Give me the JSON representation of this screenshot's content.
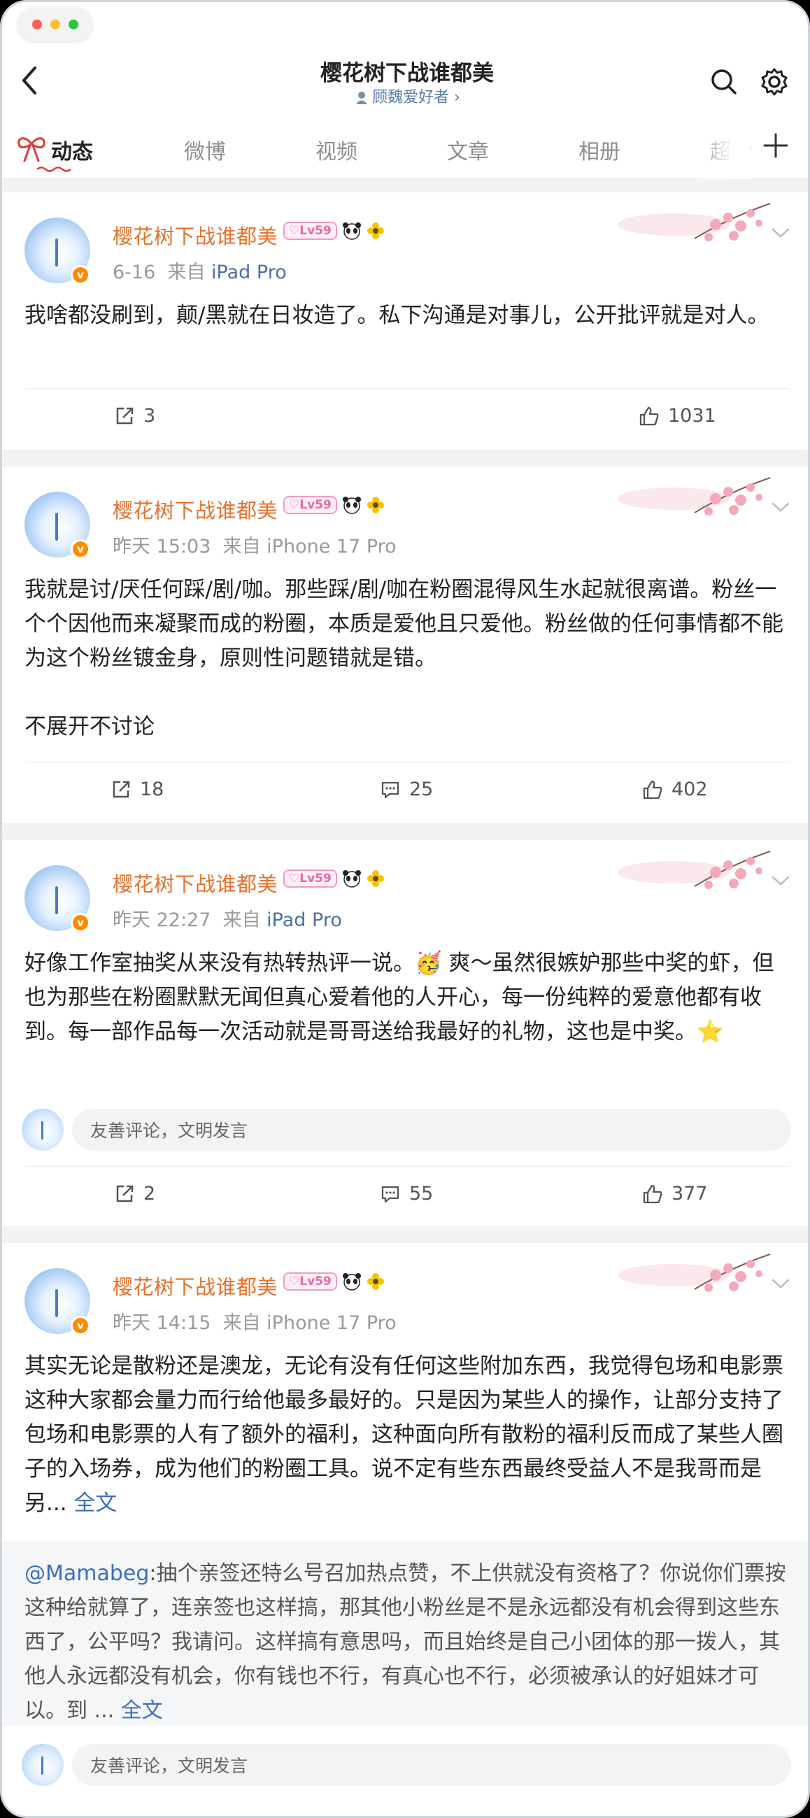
{
  "header": {
    "title": "樱花树下战谁都美",
    "subtitle": "顾魏爱好者",
    "subtitle_chevron": "›"
  },
  "tabs": [
    {
      "label": "动态",
      "active": true
    },
    {
      "label": "微博"
    },
    {
      "label": "视频"
    },
    {
      "label": "文章"
    },
    {
      "label": "相册"
    },
    {
      "label": "超话"
    }
  ],
  "colors": {
    "accent": "#e8712a",
    "link": "#3b6fbe",
    "tab_active_bow": "#e03a3a"
  },
  "icons": {
    "back": "chevron-left-icon",
    "search": "search-icon",
    "settings": "gear-icon",
    "plus": "plus-icon",
    "repost": "repost-icon",
    "comment": "comment-icon",
    "like": "thumbs-up-icon"
  },
  "posts": [
    {
      "author": "樱花树下战谁都美",
      "level": "♡Lv59",
      "verified": "v",
      "time": "6-16",
      "source_prefix": "来自",
      "source": "iPad Pro",
      "text": "我啥都没刷到，颠/黑就在日妆造了。私下沟通是对事儿，公开批评就是对人。",
      "reposts": "3",
      "likes": "1031"
    },
    {
      "author": "樱花树下战谁都美",
      "level": "♡Lv59",
      "verified": "v",
      "time": "昨天 15:03",
      "source_prefix": "来自",
      "source": "iPhone 17 Pro",
      "text": "我就是讨/厌任何踩/剧/咖。那些踩/剧/咖在粉圈混得风生水起就很离谱。粉丝一个个因他而来凝聚而成的粉圈，本质是爱他且只爱他。粉丝做的任何事情都不能为这个粉丝镀金身，原则性问题错就是错。",
      "text2": "不展开不讨论",
      "reposts": "18",
      "comments": "25",
      "likes": "402"
    },
    {
      "author": "樱花树下战谁都美",
      "level": "♡Lv59",
      "verified": "v",
      "time": "昨天 22:27",
      "source_prefix": "来自",
      "source": "iPad Pro",
      "text": "好像工作室抽奖从来没有热转热评一说。🥳 爽～虽然很嫉妒那些中奖的虾，但也为那些在粉圈默默无闻但真心爱着他的人开心，每一份纯粹的爱意他都有收到。每一部作品每一次活动就是哥哥送给我最好的礼物，这也是中奖。⭐",
      "comment_placeholder": "友善评论，文明发言",
      "reposts": "2",
      "comments": "55",
      "likes": "377"
    },
    {
      "author": "樱花树下战谁都美",
      "level": "♡Lv59",
      "verified": "v",
      "time": "昨天 14:15",
      "source_prefix": "来自",
      "source": "iPhone 17 Pro",
      "text": "其实无论是散粉还是澳龙，无论有没有任何这些附加东西，我觉得包场和电影票这种大家都会量力而行给他最多最好的。只是因为某些人的操作，让部分支持了包场和电影票的人有了额外的福利，这种面向所有散粉的福利反而成了某些人圈子的入场券，成为他们的粉圈工具。说不定有些东西最终受益人不是我哥而是另...",
      "more": "全文",
      "quote_user": "@Mamabeg",
      "quote_text": ":抽个亲签还特么号召加热点赞，不上供就没有资格了？你说你们票按这种给就算了，连亲签也这样搞，那其他小粉丝是不是永远都没有机会得到这些东西了，公平吗？我请问。这样搞有意思吗，而且始终是自己小团体的那一拨人，其他人永远都没有机会，你有钱也不行，有真心也不行，必须被承认的好姐妹才可以。到 ...",
      "quote_more": "全文",
      "comment_placeholder": "友善评论，文明发言"
    }
  ]
}
